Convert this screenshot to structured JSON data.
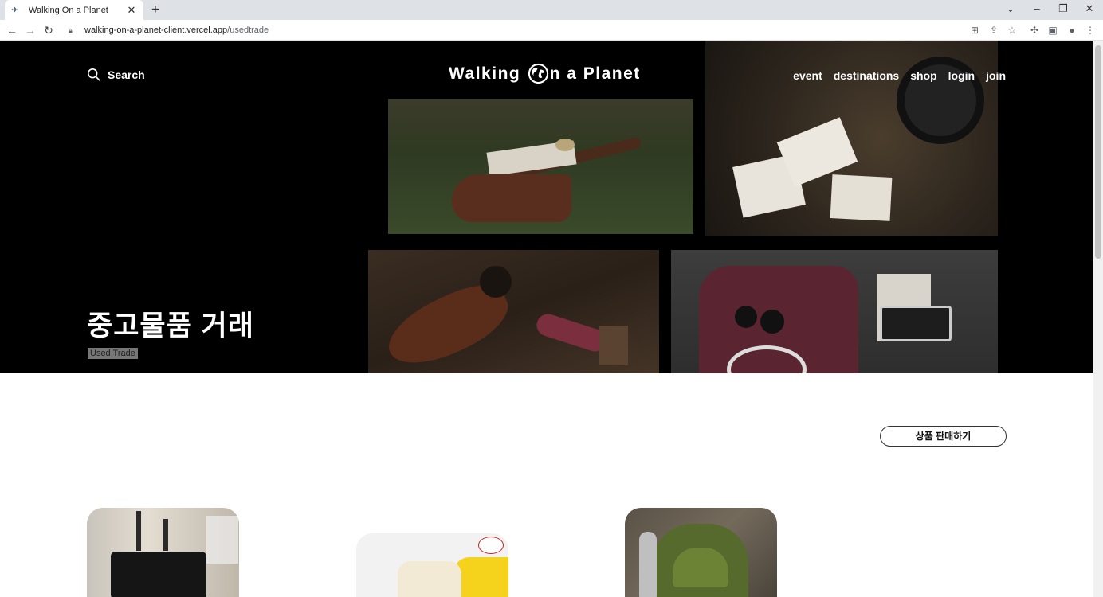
{
  "browser": {
    "tab_title": "Walking On a Planet",
    "url_host": "walking-on-a-planet-client.vercel.app",
    "url_path": "/usedtrade"
  },
  "header": {
    "search_label": "Search",
    "logo_before": "Walking ",
    "logo_after": "n a Planet",
    "nav": [
      "event",
      "destinations",
      "shop",
      "login",
      "join"
    ]
  },
  "hero": {
    "title": "중고물품 거래",
    "subtitle": "Used Trade"
  },
  "actions": {
    "sell_button": "상품 판매하기"
  },
  "products": [
    {
      "image": "suitcase-photo"
    },
    {
      "image": "cup-product-photo"
    },
    {
      "image": "deuter-backpack-photo"
    }
  ],
  "colors": {
    "hero_bg": "#000000",
    "page_bg": "#ffffff",
    "badge_bg": "#777777"
  }
}
